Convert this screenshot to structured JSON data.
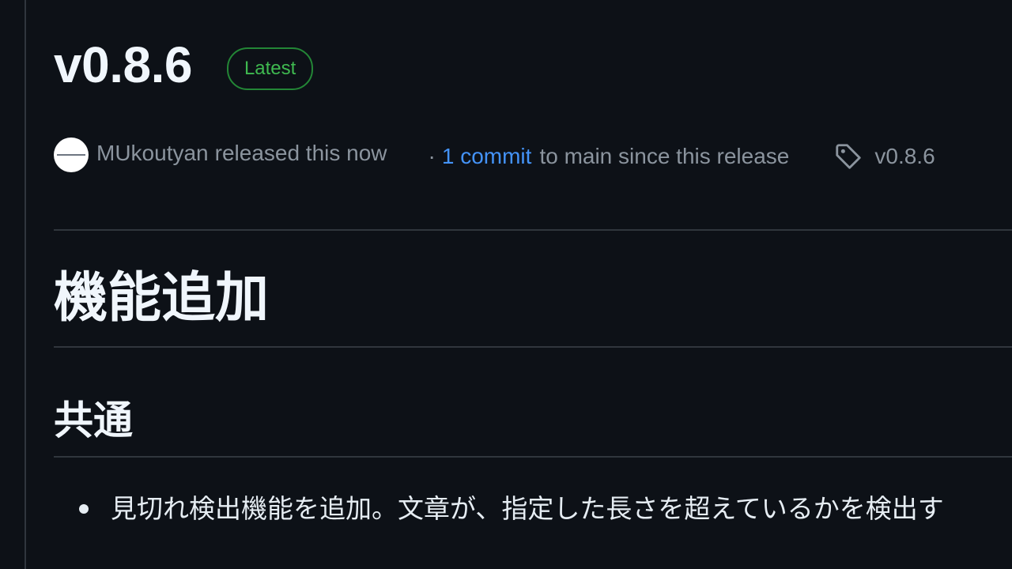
{
  "release": {
    "title": "v0.8.6",
    "badge": "Latest",
    "author": "MUkoutyan",
    "released_text": "released this now",
    "dot": "·",
    "commit_link": "1 commit",
    "commit_text": "to main since this release",
    "tag": "v0.8.6"
  },
  "body": {
    "heading": "機能追加",
    "subheading": "共通",
    "items": [
      "見切れ検出機能を追加。文章が、指定した長さを超えているかを検出す"
    ]
  },
  "colors": {
    "background": "#0d1117",
    "link": "#4493f8",
    "badge": "#3fb950",
    "muted": "#8b949e"
  },
  "icons": {
    "avatar": "user-avatar",
    "tag": "tag-icon"
  }
}
